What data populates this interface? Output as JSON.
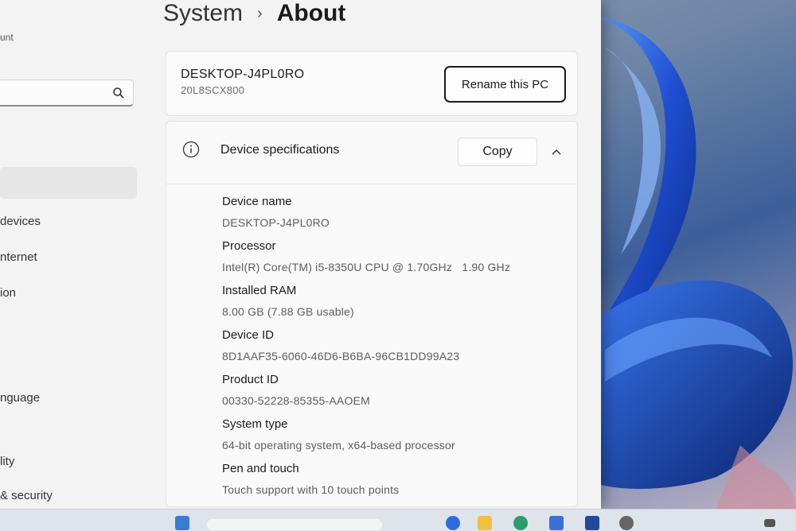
{
  "sidebar": {
    "account_label": "unt",
    "search": {
      "placeholder": ""
    },
    "items": [
      {
        "label": ""
      },
      {
        "label": " devices"
      },
      {
        "label": "nternet"
      },
      {
        "label": "ion"
      },
      {
        "label": "nguage"
      },
      {
        "label": "lity"
      },
      {
        "label": "& security"
      }
    ]
  },
  "breadcrumb": {
    "parent": "System",
    "separator": "›",
    "current": "About"
  },
  "device_card": {
    "name": "DESKTOP-J4PL0RO",
    "model": "20L8SCX800",
    "rename_label": "Rename this PC"
  },
  "specs": {
    "title": "Device specifications",
    "copy_label": "Copy",
    "items": [
      {
        "label": "Device name",
        "value": "DESKTOP-J4PL0RO"
      },
      {
        "label": "Processor",
        "value": "Intel(R) Core(TM) i5-8350U CPU @ 1.70GHz   1.90 GHz"
      },
      {
        "label": "Installed RAM",
        "value": "8.00 GB (7.88 GB usable)"
      },
      {
        "label": "Device ID",
        "value": "8D1AAF35-6060-46D6-B6BA-96CB1DD99A23"
      },
      {
        "label": "Product ID",
        "value": "00330-52228-85355-AAOEM"
      },
      {
        "label": "System type",
        "value": "64-bit operating system, x64-based processor"
      },
      {
        "label": "Pen and touch",
        "value": "Touch support with 10 touch points"
      }
    ]
  },
  "icons": {
    "search": "search-icon",
    "info": "info-icon",
    "collapse": "chevron-up-icon"
  },
  "colors": {
    "accent_wallpaper": "#1f4fd1",
    "window_bg": "#f3f3f3",
    "card_bg": "#fbfbfb"
  }
}
